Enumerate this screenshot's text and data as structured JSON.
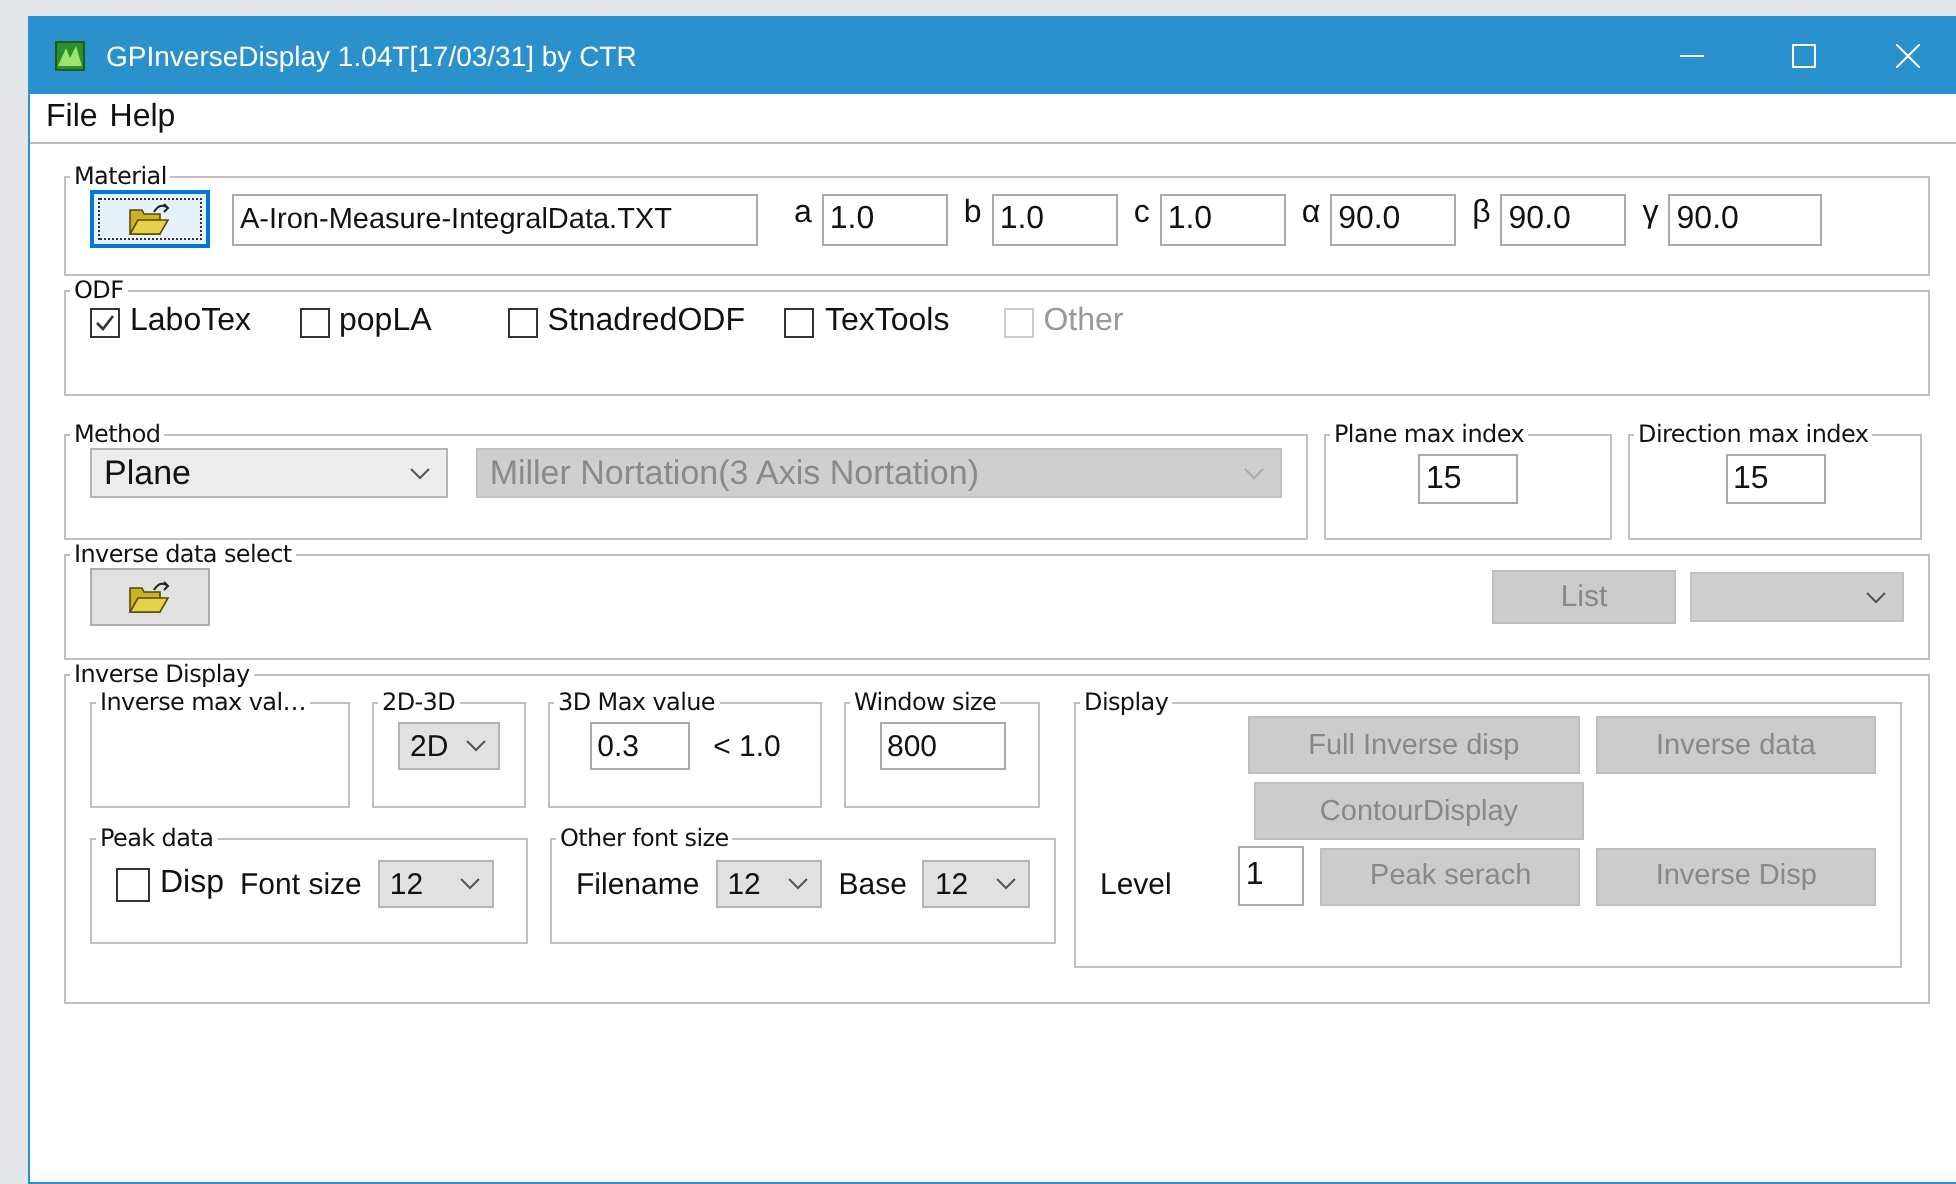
{
  "window": {
    "title": "GPInverseDisplay 1.04T[17/03/31] by CTR"
  },
  "menu": [
    "File",
    "Help"
  ],
  "material": {
    "legend": "Material",
    "filename": "A-Iron-Measure-IntegralData.TXT",
    "params": [
      {
        "label": "a",
        "value": "1.0"
      },
      {
        "label": "b",
        "value": "1.0"
      },
      {
        "label": "c",
        "value": "1.0"
      },
      {
        "label": "α",
        "value": "90.0"
      },
      {
        "label": "β",
        "value": "90.0"
      },
      {
        "label": "γ",
        "value": "90.0"
      }
    ]
  },
  "odf": {
    "legend": "ODF",
    "options": [
      {
        "label": "LaboTex",
        "checked": true,
        "disabled": false
      },
      {
        "label": "popLA",
        "checked": false,
        "disabled": false
      },
      {
        "label": "StnadredODF",
        "checked": false,
        "disabled": false
      },
      {
        "label": "TexTools",
        "checked": false,
        "disabled": false
      },
      {
        "label": "Other",
        "checked": false,
        "disabled": true
      }
    ]
  },
  "method": {
    "legend": "Method",
    "dropdowns": [
      {
        "value": "Plane",
        "disabled": false
      },
      {
        "value": "Miller Nortation(3 Axis Nortation)",
        "disabled": true
      }
    ]
  },
  "plane_max_index": {
    "legend": "Plane max index",
    "value": "15"
  },
  "direction_max_index": {
    "legend": "Direction max index",
    "value": "15"
  },
  "inverse_data_select": {
    "legend": "Inverse data select",
    "list_button": {
      "label": "List",
      "disabled": true
    },
    "dropdown": {
      "disabled": true
    }
  },
  "inverse_display": {
    "legend": "Inverse Display",
    "inverse_max_value": {
      "legend": "Inverse max val…"
    },
    "dimension": {
      "legend": "2D-3D",
      "value": "2D"
    },
    "max_value_3d": {
      "legend": "3D Max value",
      "value": "0.3",
      "limit": "< 1.0"
    },
    "window_size": {
      "legend": "Window size",
      "value": "800"
    },
    "peak_data": {
      "legend": "Peak data",
      "disp": {
        "label": "Disp",
        "checked": false
      },
      "font_size_label": "Font size",
      "font_size": "12"
    },
    "other_font_size": {
      "legend": "Other font size",
      "fields": [
        {
          "label": "Filename",
          "value": "12"
        },
        {
          "label": "Base",
          "value": "12"
        }
      ]
    },
    "display": {
      "legend": "Display",
      "level_label": "Level",
      "level_value": "1",
      "buttons": [
        {
          "label": "Full Inverse disp",
          "disabled": true
        },
        {
          "label": "Inverse data",
          "disabled": true
        },
        {
          "label": "ContourDisplay",
          "disabled": true
        },
        {
          "label": "Peak serach",
          "disabled": true
        },
        {
          "label": "Inverse Disp",
          "disabled": true
        }
      ]
    }
  }
}
